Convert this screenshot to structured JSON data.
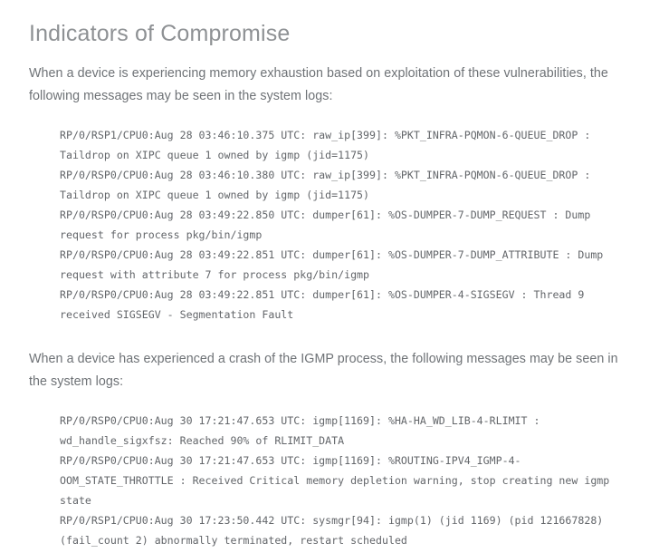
{
  "section": {
    "title": "Indicators of Compromise",
    "paragraph_1": "When a device is experiencing memory exhaustion based on exploitation of these vulnerabilities, the following messages may be seen in the system logs:",
    "paragraph_2": "When a device has experienced a crash of the IGMP process, the following messages may be seen in the system logs:"
  },
  "log_block_1": {
    "lines": [
      "RP/0/RSP1/CPU0:Aug 28 03:46:10.375 UTC: raw_ip[399]: %PKT_INFRA-PQMON-6-QUEUE_DROP : Taildrop on XIPC queue 1 owned by igmp (jid=1175)",
      "RP/0/RSP0/CPU0:Aug 28 03:46:10.380 UTC: raw_ip[399]: %PKT_INFRA-PQMON-6-QUEUE_DROP : Taildrop on XIPC queue 1 owned by igmp (jid=1175)",
      "RP/0/RSP0/CPU0:Aug 28 03:49:22.850 UTC: dumper[61]: %OS-DUMPER-7-DUMP_REQUEST : Dump request for process pkg/bin/igmp",
      "RP/0/RSP0/CPU0:Aug 28 03:49:22.851 UTC: dumper[61]: %OS-DUMPER-7-DUMP_ATTRIBUTE : Dump request with attribute 7 for process pkg/bin/igmp",
      "RP/0/RSP0/CPU0:Aug 28 03:49:22.851 UTC: dumper[61]: %OS-DUMPER-4-SIGSEGV : Thread 9 received SIGSEGV - Segmentation Fault"
    ]
  },
  "log_block_2": {
    "lines": [
      "RP/0/RSP0/CPU0:Aug 30 17:21:47.653 UTC: igmp[1169]: %HA-HA_WD_LIB-4-RLIMIT : wd_handle_sigxfsz: Reached 90% of RLIMIT_DATA",
      "RP/0/RSP0/CPU0:Aug 30 17:21:47.653 UTC: igmp[1169]: %ROUTING-IPV4_IGMP-4-OOM_STATE_THROTTLE : Received Critical memory depletion warning, stop creating new igmp state",
      "RP/0/RSP1/CPU0:Aug 30 17:23:50.442 UTC: sysmgr[94]: igmp(1) (jid 1169) (pid 121667828) (fail_count 2) abnormally terminated, restart scheduled"
    ]
  },
  "colors": {
    "background": "#ffffff",
    "heading": "#8e9194",
    "body_text": "#6e7276",
    "code_text": "#63666a"
  }
}
